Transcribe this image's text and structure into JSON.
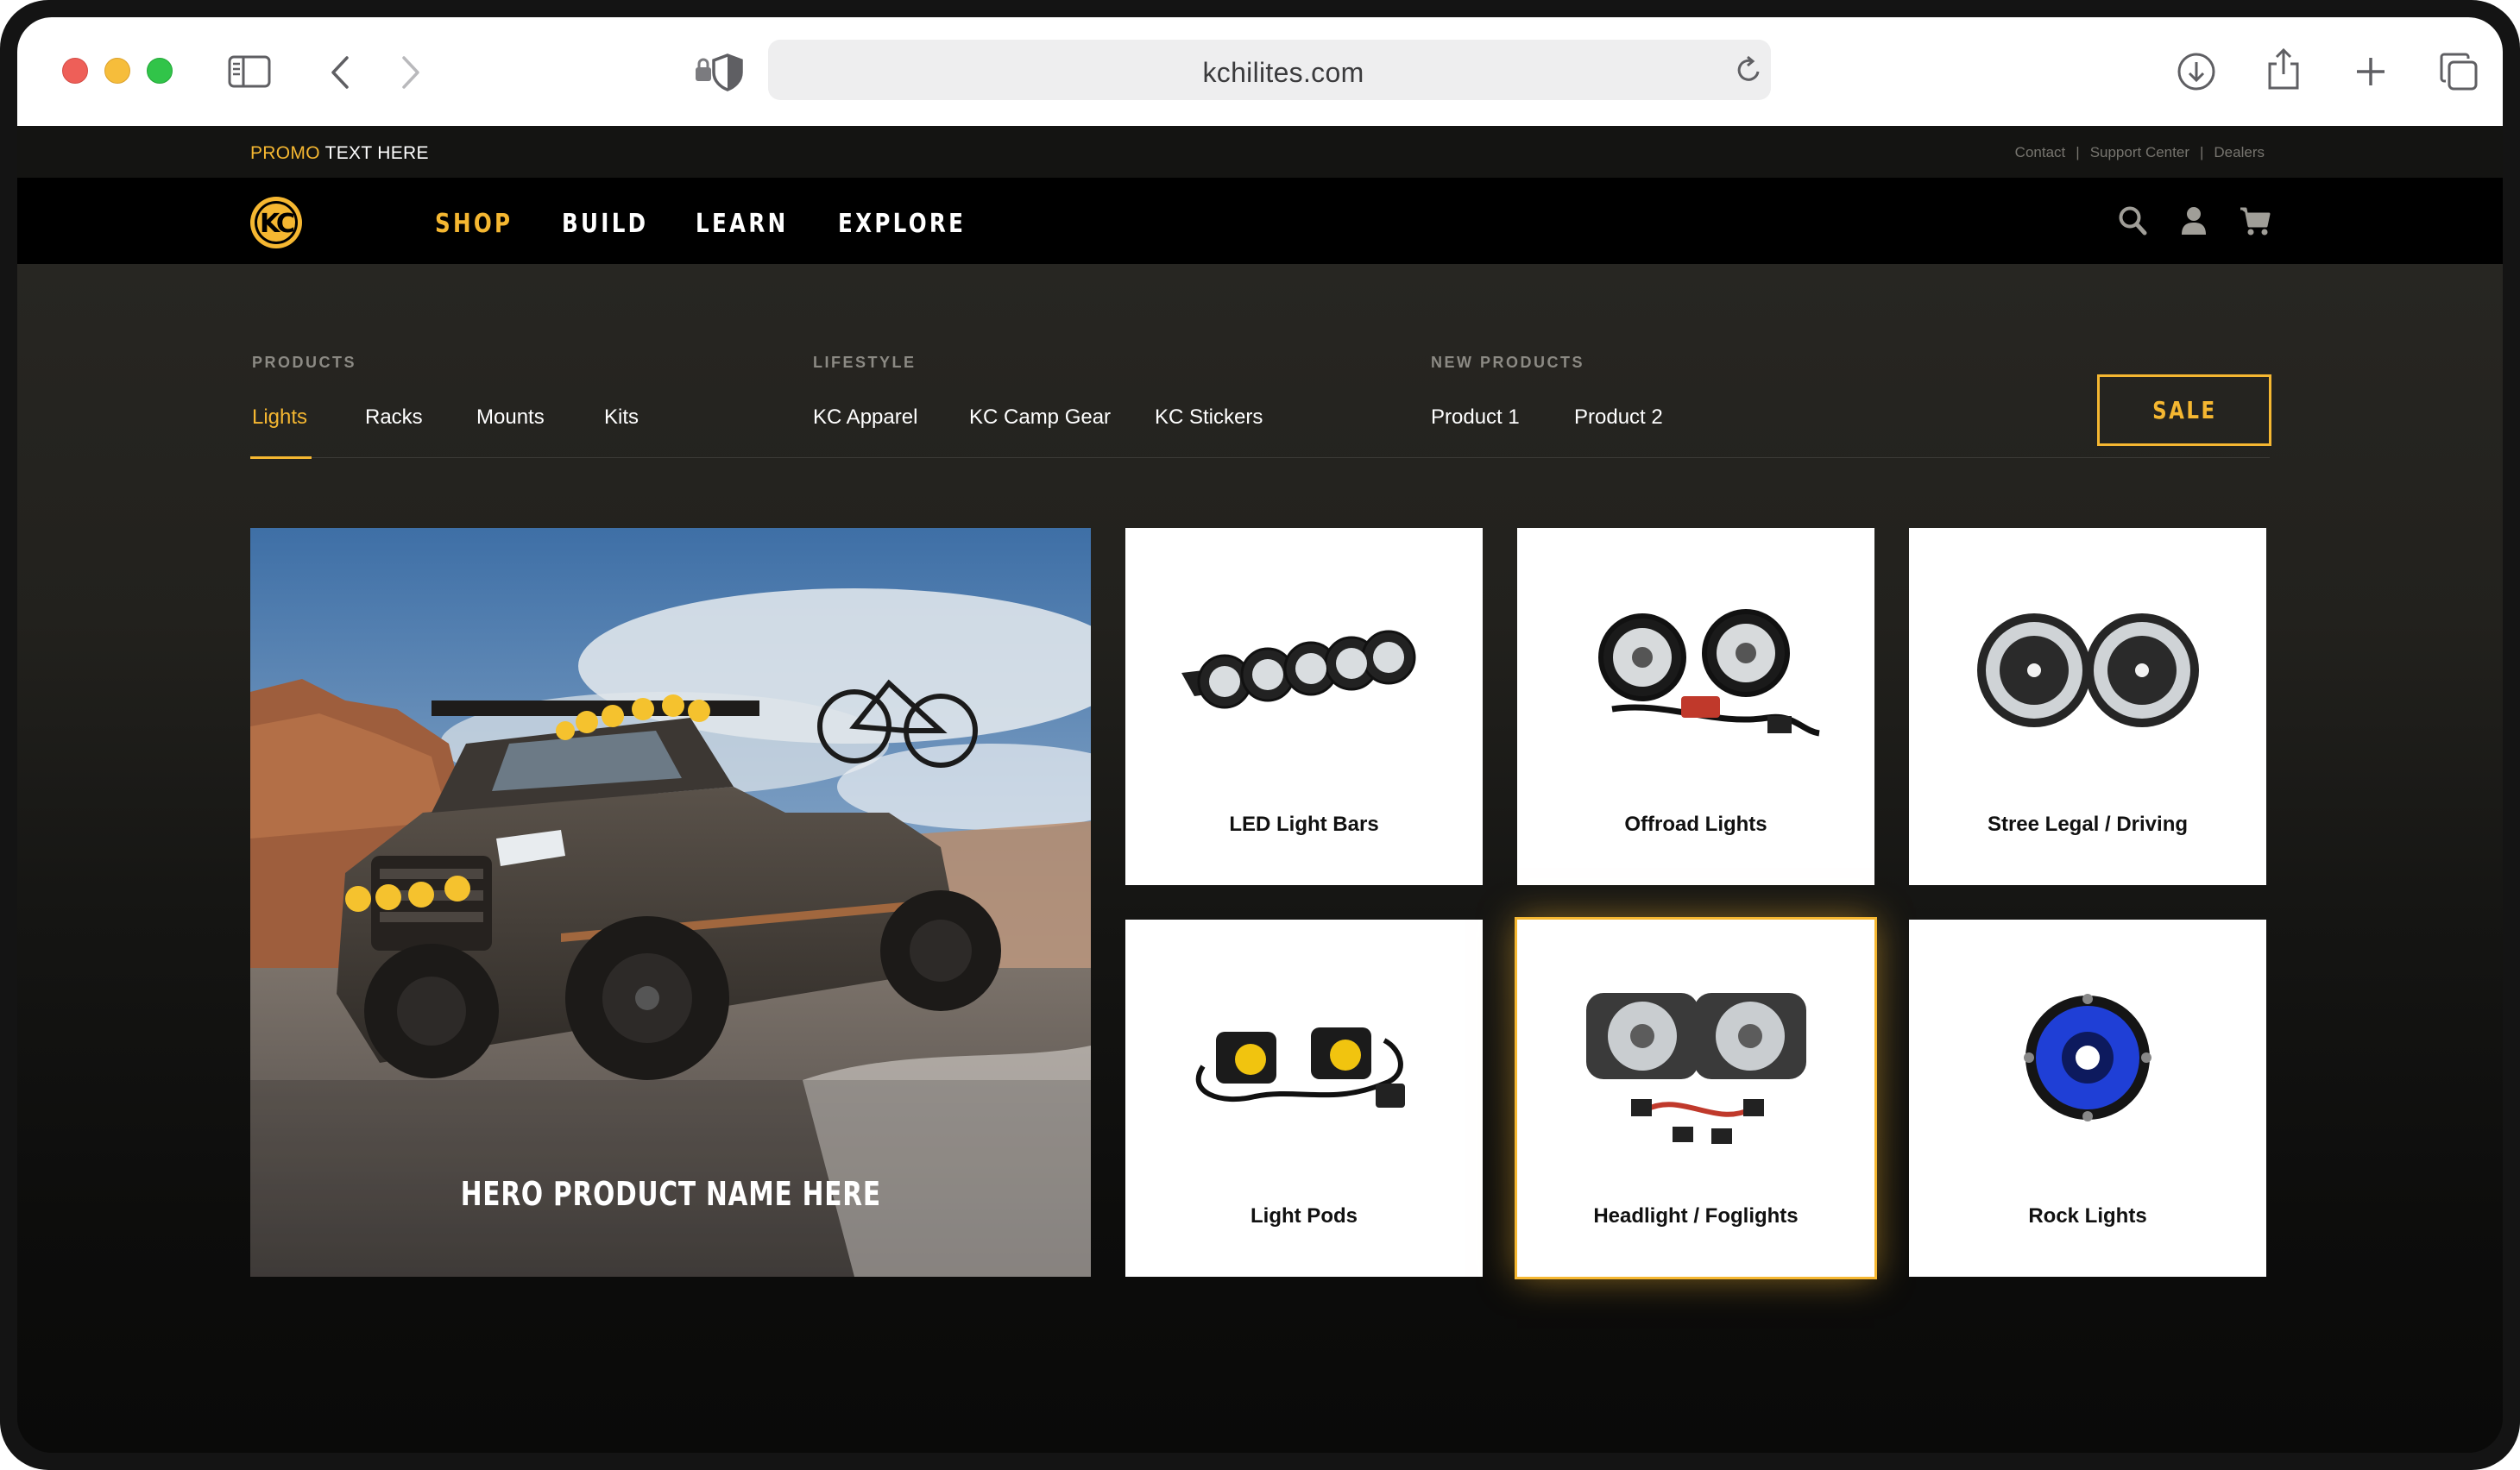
{
  "browser": {
    "url": "kchilites.com"
  },
  "site": {
    "promo": {
      "accent": "PROMO",
      "text": " TEXT HERE"
    },
    "utility_links": [
      "Contact",
      "Support Center",
      "Dealers"
    ],
    "utility_separator": "|",
    "nav": [
      "SHOP",
      "BUILD",
      "LEARN",
      "EXPLORE"
    ],
    "active_nav": "SHOP",
    "brand_color": "#f5b731"
  },
  "menu": {
    "groups": [
      {
        "heading": "PRODUCTS",
        "links": [
          "Lights",
          "Racks",
          "Mounts",
          "Kits"
        ]
      },
      {
        "heading": "LIFESTYLE",
        "links": [
          "KC Apparel",
          "KC Camp Gear",
          "KC Stickers"
        ]
      },
      {
        "heading": "NEW PRODUCTS",
        "links": [
          "Product 1",
          "Product 2"
        ]
      }
    ],
    "active_link": "Lights",
    "sale_label": "SALE"
  },
  "hero": {
    "label": "HERO PRODUCT NAME HERE"
  },
  "categories": [
    {
      "label": "LED Light Bars",
      "icon": "light-bar"
    },
    {
      "label": "Offroad Lights",
      "icon": "offroad-lights"
    },
    {
      "label": "Stree Legal / Driving",
      "icon": "driving-lights"
    },
    {
      "label": "Light Pods",
      "icon": "light-pods"
    },
    {
      "label": "Headlight / Foglights",
      "icon": "headlights",
      "highlighted": true
    },
    {
      "label": "Rock Lights",
      "icon": "rock-light"
    }
  ]
}
